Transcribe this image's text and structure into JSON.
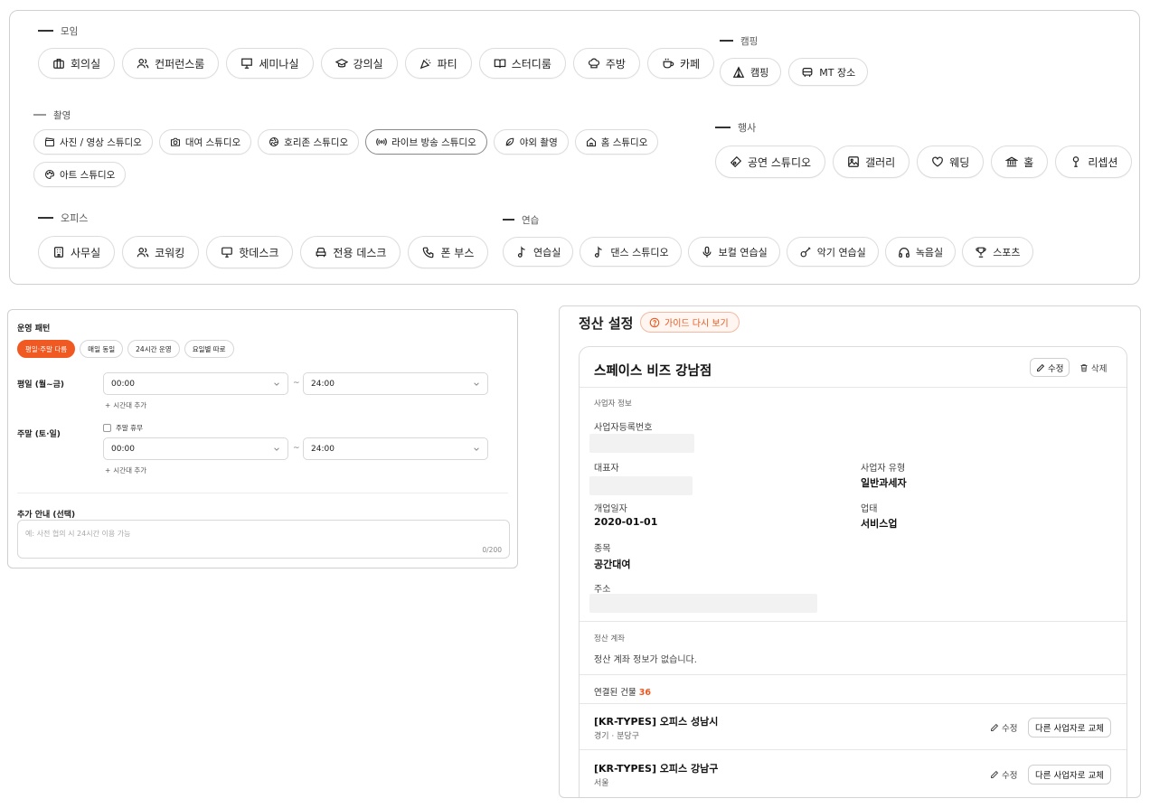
{
  "categories": {
    "meeting": {
      "title": "모임",
      "items": [
        {
          "label": "회의실",
          "icon": "briefcase-icon"
        },
        {
          "label": "컨퍼런스룸",
          "icon": "users-icon"
        },
        {
          "label": "세미나실",
          "icon": "presentation-icon"
        },
        {
          "label": "강의실",
          "icon": "graduation-cap-icon"
        },
        {
          "label": "파티",
          "icon": "party-popper-icon"
        },
        {
          "label": "스터디룸",
          "icon": "book-open-icon"
        },
        {
          "label": "주방",
          "icon": "chef-hat-icon"
        },
        {
          "label": "카페",
          "icon": "coffee-icon"
        }
      ]
    },
    "camping": {
      "title": "캠핑",
      "items": [
        {
          "label": "캠핑",
          "icon": "tent-icon"
        },
        {
          "label": "MT 장소",
          "icon": "bus-icon"
        }
      ]
    },
    "shooting": {
      "title": "촬영",
      "items": [
        {
          "label": "사진 / 영상 스튜디오",
          "icon": "clapperboard-icon"
        },
        {
          "label": "대여 스튜디오",
          "icon": "camera-icon"
        },
        {
          "label": "호리존 스튜디오",
          "icon": "aperture-icon"
        },
        {
          "label": "라이브 방송 스튜디오",
          "icon": "broadcast-icon"
        },
        {
          "label": "야외 촬영",
          "icon": "leaf-icon"
        },
        {
          "label": "홈 스튜디오",
          "icon": "home-icon"
        },
        {
          "label": "아트 스튜디오",
          "icon": "palette-icon"
        }
      ]
    },
    "event": {
      "title": "행사",
      "items": [
        {
          "label": "공연 스튜디오",
          "icon": "ticket-icon"
        },
        {
          "label": "갤러리",
          "icon": "image-icon"
        },
        {
          "label": "웨딩",
          "icon": "heart-icon"
        },
        {
          "label": "홀",
          "icon": "landmark-icon"
        },
        {
          "label": "리셉션",
          "icon": "microphone-stand-icon"
        }
      ]
    },
    "office": {
      "title": "오피스",
      "items": [
        {
          "label": "사무실",
          "icon": "building-icon"
        },
        {
          "label": "코워킹",
          "icon": "users-icon"
        },
        {
          "label": "핫데스크",
          "icon": "monitor-icon"
        },
        {
          "label": "전용 데스크",
          "icon": "armchair-icon"
        },
        {
          "label": "폰 부스",
          "icon": "phone-icon"
        }
      ]
    },
    "practice": {
      "title": "연습",
      "items": [
        {
          "label": "연습실",
          "icon": "music-note-icon"
        },
        {
          "label": "댄스 스튜디오",
          "icon": "music-note-icon"
        },
        {
          "label": "보컬 연습실",
          "icon": "mic-icon"
        },
        {
          "label": "악기 연습실",
          "icon": "guitar-icon"
        },
        {
          "label": "녹음실",
          "icon": "headphones-icon"
        },
        {
          "label": "스포츠",
          "icon": "trophy-icon"
        }
      ]
    }
  },
  "operation": {
    "pattern_label": "운영 패턴",
    "patterns": [
      "평일·주말 다름",
      "매일 동일",
      "24시간 운영",
      "요일별 따로"
    ],
    "weekday_label": "평일 (월~금)",
    "weekday_start": "00:00",
    "weekday_end": "24:00",
    "add_slot": "시간대 추가",
    "weekend_label": "주말 (토·일)",
    "weekend_closed": "주말 휴무",
    "weekend_start": "00:00",
    "weekend_end": "24:00",
    "tilde": "~",
    "extra_label": "추가 안내 (선택)",
    "extra_placeholder": "예: 사전 협의 시 24시간 이용 가능",
    "extra_counter": "0/200"
  },
  "settlement": {
    "title": "정산 설정",
    "guide_button": "가이드 다시 보기",
    "business_name": "스페이스 비즈 강남점",
    "edit": "수정",
    "delete": "삭제",
    "business_info_label": "사업자 정보",
    "reg_no_label": "사업자등록번호",
    "ceo_label": "대표자",
    "biz_type_label": "사업자 유형",
    "biz_type_value": "일반과세자",
    "open_date_label": "개업일자",
    "open_date_value": "2020-01-01",
    "industry_label": "업태",
    "industry_value": "서비스업",
    "item_label": "종목",
    "item_value": "공간대여",
    "address_label": "주소",
    "account_label": "정산 계좌",
    "account_empty": "정산 계좌 정보가 없습니다.",
    "linked_label": "연결된 건물",
    "linked_count": "36",
    "buildings": [
      {
        "name": "[KR-TYPES] 오피스 성남시",
        "region": "경기 · 분당구"
      },
      {
        "name": "[KR-TYPES] 오피스 강남구",
        "region": "서울"
      }
    ],
    "swap_button": "다른 사업자로 교체"
  },
  "colors": {
    "accent": "#f05a22",
    "border": "#d0d0d0"
  }
}
